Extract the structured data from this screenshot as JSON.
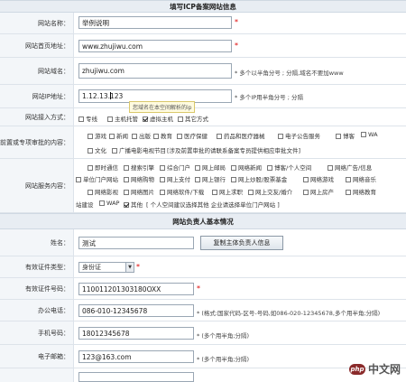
{
  "section1": {
    "title": "填写ICP备案网站信息"
  },
  "site_name": {
    "label": "网站名称：",
    "value": "举例说明",
    "required": "*"
  },
  "home_url": {
    "label": "网站首页地址：",
    "value": "www.zhujiwu.com",
    "required": "*"
  },
  "domain": {
    "label": "网站域名：",
    "value": "zhujiwu.com",
    "hint": "* 多个以半角分号 ; 分隔,域名不要加www"
  },
  "ip": {
    "label": "网站IP地址：",
    "value": "1.12.13.123",
    "hint": "* 多个IP用半角分号 ; 分隔",
    "tooltip": "您域名在本空间解析的ip"
  },
  "access": {
    "label": "网站接入方式：",
    "options": [
      {
        "label": "专线",
        "checked": false
      },
      {
        "label": "主机托管",
        "checked": false
      },
      {
        "label": "虚拟主机",
        "checked": true
      },
      {
        "label": "其它方式",
        "checked": false
      }
    ]
  },
  "preapproval": {
    "label": "前置或专项审批的内容：",
    "options_line1": [
      "游戏",
      "新闻",
      "出版",
      "教育",
      "医疗保健",
      "药品和医疗器械",
      "电子公告服务",
      "博客",
      "WA"
    ],
    "options_line2": [
      "文化",
      "广播电影电视节目"
    ],
    "note": "[涉及前置审批的请联系备案专员提供相应审批文件]"
  },
  "services": {
    "label": "网站服务内容：",
    "line1": [
      "即时通信",
      "搜索引擎",
      "综合门户",
      "网上邮局",
      "网络新闻",
      "博客/个人空间",
      "网络广告/信息"
    ],
    "line2": [
      "单位门户网站",
      "网络购物",
      "网上支付",
      "网上银行",
      "网上炒股/股票基金",
      "网络游戏",
      "网络音乐"
    ],
    "line3": [
      "网络影视",
      "网络图片",
      "网络软件/下载",
      "网上求职",
      "网上交友/婚介",
      "网上房产",
      "网络教育"
    ],
    "line4_prefix": "站建设",
    "line4": [
      {
        "label": "WAP",
        "checked": false
      },
      {
        "label": "其他",
        "checked": true
      }
    ],
    "note": "[ 个人空间建议选择其他  企业请选择单位门户网站 ]"
  },
  "section2": {
    "title": "网站负责人基本情况"
  },
  "owner_name": {
    "label": "姓名：",
    "value": "测试",
    "button": "复制主体负责人信息"
  },
  "id_type": {
    "label": "有效证件类型：",
    "value": "身份证",
    "required": "*"
  },
  "id_number": {
    "label": "有效证件号码：",
    "value": "110011201303180OXX",
    "required": "*"
  },
  "office_phone": {
    "label": "办公电话：",
    "value": "086-010-12345678",
    "hint": "* (格式:国家代码-区号-号码,如086-020-12345678,多个用半角;分隔)"
  },
  "mobile": {
    "label": "手机号码：",
    "value": "18012345678",
    "hint": "* (多个用半角;分隔)"
  },
  "email": {
    "label": "电子邮箱：",
    "value": "123@163.com",
    "hint": "* (多个用半角;分隔)"
  },
  "watermark": {
    "text": "中文网",
    "logo": "php"
  }
}
